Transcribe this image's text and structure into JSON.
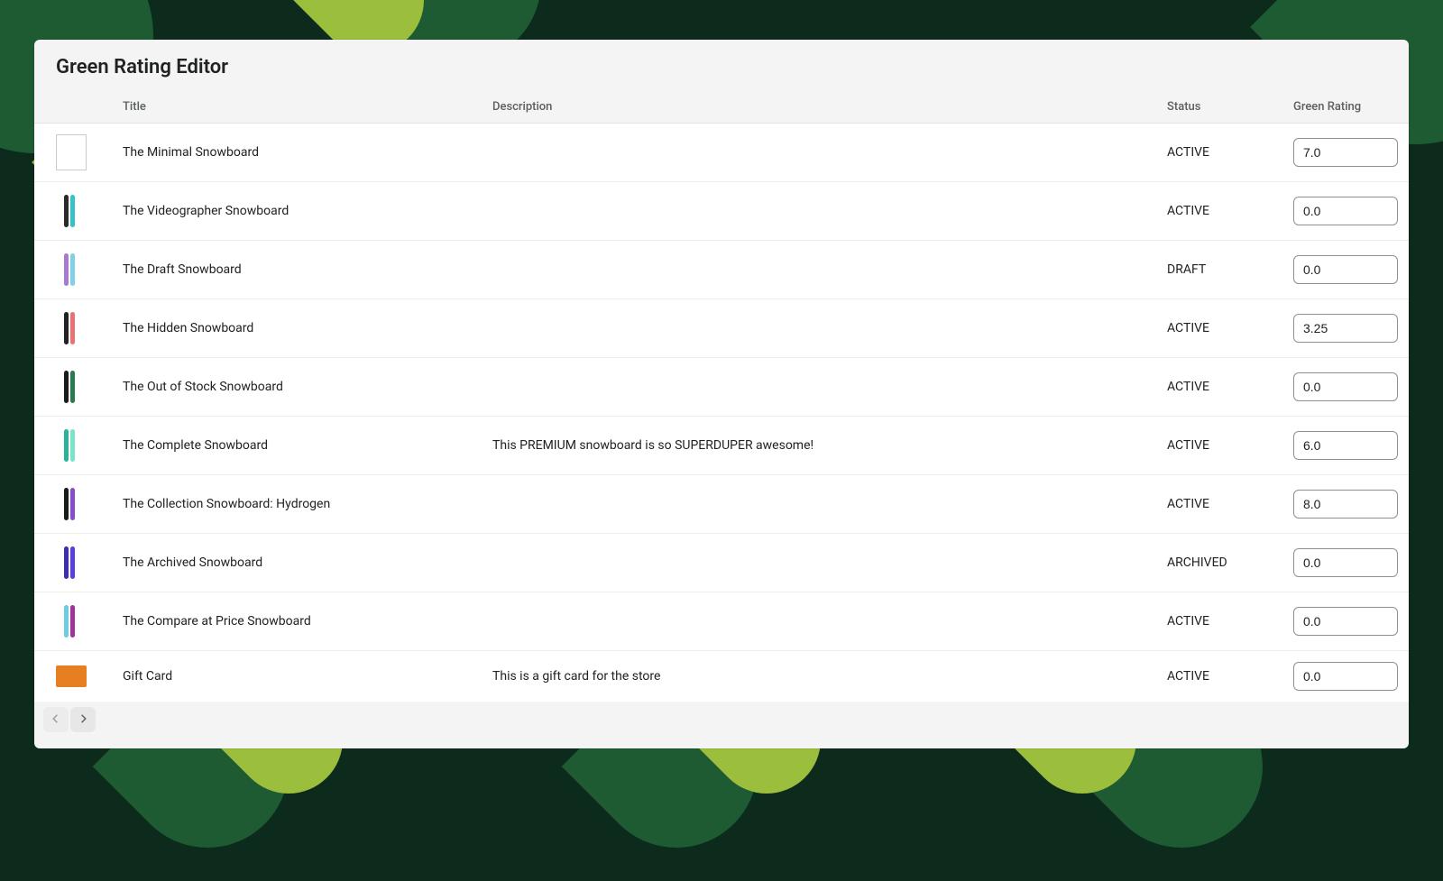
{
  "page": {
    "title": "Green Rating Editor"
  },
  "columns": {
    "thumb": "",
    "title": "Title",
    "description": "Description",
    "status": "Status",
    "rating": "Green Rating"
  },
  "rows": [
    {
      "title": "The Minimal Snowboard",
      "description": "",
      "status": "ACTIVE",
      "rating": "7.0",
      "thumb": {
        "type": "placeholder",
        "colors": []
      }
    },
    {
      "title": "The Videographer Snowboard",
      "description": "",
      "status": "ACTIVE",
      "rating": "0.0",
      "thumb": {
        "type": "boards",
        "colors": [
          "#2a2a2a",
          "#36c2c8"
        ]
      }
    },
    {
      "title": "The Draft Snowboard",
      "description": "",
      "status": "DRAFT",
      "rating": "0.0",
      "thumb": {
        "type": "boards",
        "colors": [
          "#a47bd1",
          "#7fd0e8"
        ]
      }
    },
    {
      "title": "The Hidden Snowboard",
      "description": "",
      "status": "ACTIVE",
      "rating": "3.25",
      "thumb": {
        "type": "boards",
        "colors": [
          "#222",
          "#e97373"
        ]
      }
    },
    {
      "title": "The Out of Stock Snowboard",
      "description": "",
      "status": "ACTIVE",
      "rating": "0.0",
      "thumb": {
        "type": "boards",
        "colors": [
          "#1b1b1b",
          "#2a7a4d"
        ]
      }
    },
    {
      "title": "The Complete Snowboard",
      "description": "This PREMIUM snowboard is so SUPERDUPER awesome!",
      "status": "ACTIVE",
      "rating": "6.0",
      "thumb": {
        "type": "boards",
        "colors": [
          "#2bb39a",
          "#7be3c9"
        ]
      }
    },
    {
      "title": "The Collection Snowboard: Hydrogen",
      "description": "",
      "status": "ACTIVE",
      "rating": "8.0",
      "thumb": {
        "type": "boards",
        "colors": [
          "#1a1a1a",
          "#8a4dc9"
        ]
      }
    },
    {
      "title": "The Archived Snowboard",
      "description": "",
      "status": "ARCHIVED",
      "rating": "0.0",
      "thumb": {
        "type": "boards",
        "colors": [
          "#3b2fb0",
          "#5a3fe0"
        ]
      }
    },
    {
      "title": "The Compare at Price Snowboard",
      "description": "",
      "status": "ACTIVE",
      "rating": "0.0",
      "thumb": {
        "type": "boards",
        "colors": [
          "#6fcbe0",
          "#a0329a"
        ]
      }
    },
    {
      "title": "Gift Card",
      "description": "This is a gift card for the store",
      "status": "ACTIVE",
      "rating": "0.0",
      "thumb": {
        "type": "card",
        "colors": []
      }
    }
  ],
  "pager": {
    "prev_disabled": true,
    "next_disabled": false
  }
}
